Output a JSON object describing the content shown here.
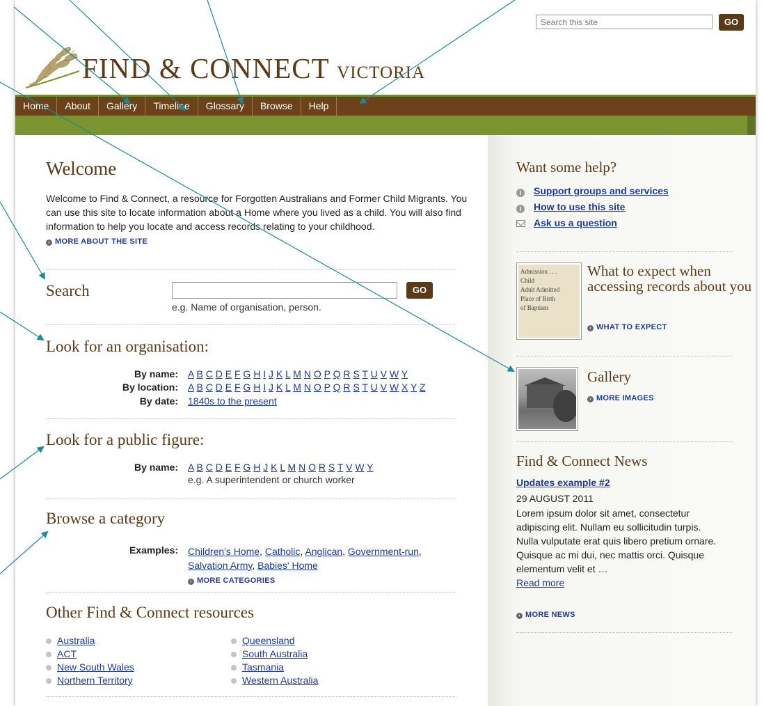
{
  "header": {
    "search_placeholder": "Search this site",
    "go_label": "GO",
    "logo_main": "FIND & CONNECT",
    "logo_sub": "VICTORIA"
  },
  "nav": [
    "Home",
    "About",
    "Gallery",
    "Timeline",
    "Glossary",
    "Browse",
    "Help"
  ],
  "welcome": {
    "title": "Welcome",
    "text": "Welcome to Find & Connect, a resource for Forgotten Australians and Former Child Migrants. You can use this site to locate information about a Home where you lived as a child. You will also find information to help you locate and access records relating to your childhood.",
    "more": "MORE ABOUT THE SITE"
  },
  "search": {
    "title": "Search",
    "go_label": "GO",
    "hint": "e.g. Name of organisation, person."
  },
  "org": {
    "title": "Look for an organisation:",
    "by_name_label": "By name:",
    "by_name_letters": [
      "A",
      "B",
      "C",
      "D",
      "E",
      "F",
      "G",
      "H",
      "I",
      "J",
      "K",
      "L",
      "M",
      "N",
      "O",
      "P",
      "Q",
      "R",
      "S",
      "T",
      "U",
      "V",
      "W",
      "Y"
    ],
    "by_location_label": "By location:",
    "by_location_letters": [
      "A",
      "B",
      "C",
      "D",
      "E",
      "F",
      "G",
      "H",
      "I",
      "J",
      "K",
      "L",
      "M",
      "N",
      "O",
      "P",
      "Q",
      "R",
      "S",
      "T",
      "U",
      "V",
      "W",
      "X",
      "Y",
      "Z"
    ],
    "by_date_label": "By date:",
    "by_date_link": "1840s to the present"
  },
  "public_figure": {
    "title": "Look for a public figure:",
    "by_name_label": "By name:",
    "letters": [
      "A",
      "B",
      "C",
      "D",
      "E",
      "F",
      "G",
      "H",
      "J",
      "K",
      "L",
      "M",
      "N",
      "O",
      "R",
      "S",
      "T",
      "V",
      "W",
      "Y"
    ],
    "hint": "e.g. A superintendent or church worker"
  },
  "category": {
    "title": "Browse a category",
    "examples_label": "Examples:",
    "links": [
      "Children's Home",
      "Catholic",
      "Anglican",
      "Government-run",
      "Salvation Army",
      "Babies' Home"
    ],
    "more": "MORE CATEGORIES"
  },
  "resources": {
    "title": "Other Find & Connect resources",
    "col1": [
      "Australia",
      "ACT",
      "New South Wales",
      "Northern Territory"
    ],
    "col2": [
      "Queensland",
      "South Australia",
      "Tasmania",
      "Western Australia"
    ]
  },
  "sidebar": {
    "help_title": "Want some help?",
    "help_links": [
      "Support groups and services",
      "How to use this site",
      "Ask us a question"
    ],
    "expect_title": "What to expect when accessing records about you",
    "expect_more": "WHAT TO EXPECT",
    "doc_thumb_lines": [
      "Admission . . .",
      "Child",
      "Adult  Admitted",
      "Place of Birth",
      "of Baptism"
    ],
    "gallery_title": "Gallery",
    "gallery_more": "MORE IMAGES",
    "news_title": "Find & Connect News",
    "news_headline": "Updates example #2",
    "news_date": "29 AUGUST 2011",
    "news_body": "Lorem ipsum dolor sit amet, consectetur adipiscing elit. Nullam eu sollicitudin turpis. Nulla vulputate erat quis libero pretium ornare. Quisque ac mi dui, nec mattis orci. Quisque elementum velit et …",
    "read_more": "Read more",
    "news_more": "MORE NEWS"
  },
  "colors": {
    "brown": "#6b4219",
    "heading": "#5a3a17",
    "green": "#7a9530",
    "link": "#1f3a93",
    "annotation": "#1a8a9a"
  }
}
